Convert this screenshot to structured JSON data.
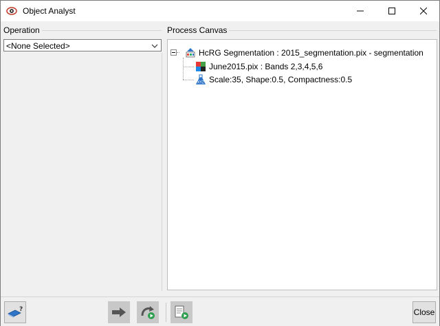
{
  "window": {
    "title": "Object Analyst"
  },
  "operation": {
    "group_label": "Operation",
    "selected": "<None Selected>"
  },
  "canvas": {
    "group_label": "Process Canvas",
    "root": {
      "label": "HcRG Segmentation : 2015_segmentation.pix - segmentation",
      "expanded": true
    },
    "children": [
      {
        "label": "June2015.pix : Bands 2,3,4,5,6",
        "icon": "raster-bands-icon"
      },
      {
        "label": "Scale:35, Shape:0.5, Compactness:0.5",
        "icon": "flask-parameters-icon"
      }
    ]
  },
  "footer": {
    "close_label": "Close"
  }
}
